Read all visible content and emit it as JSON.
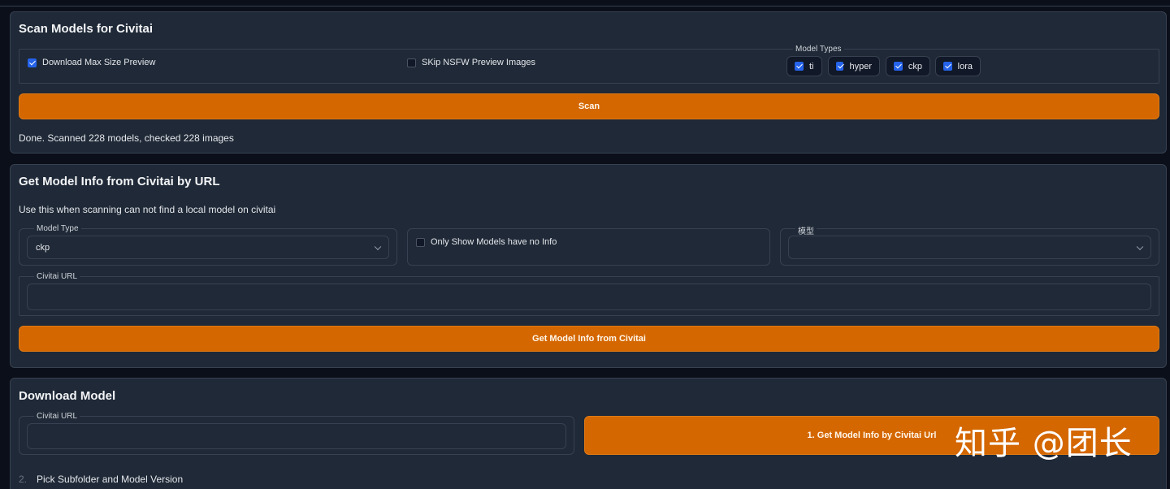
{
  "scan_section": {
    "title": "Scan Models for Civitai",
    "download_max_preview": {
      "label": "Download Max Size Preview",
      "checked": true
    },
    "skip_nsfw": {
      "label": "SKip NSFW Preview Images",
      "checked": false
    },
    "model_types": {
      "legend": "Model Types",
      "options": [
        {
          "label": "ti",
          "checked": true
        },
        {
          "label": "hyper",
          "checked": true
        },
        {
          "label": "ckp",
          "checked": true
        },
        {
          "label": "lora",
          "checked": true
        }
      ]
    },
    "scan_button": "Scan",
    "status": "Done. Scanned 228 models, checked 228 images"
  },
  "url_section": {
    "title": "Get Model Info from Civitai by URL",
    "description": "Use this when scanning can not find a local model on civitai",
    "model_type": {
      "label": "Model Type",
      "value": "ckp"
    },
    "only_no_info": {
      "label": "Only Show Models have no Info",
      "checked": false
    },
    "model_select": {
      "label": "模型",
      "value": ""
    },
    "civitai_url": {
      "label": "Civitai URL",
      "value": ""
    },
    "get_info_button": "Get Model Info from Civitai"
  },
  "download_section": {
    "title": "Download Model",
    "civitai_url": {
      "label": "Civitai URL",
      "value": ""
    },
    "step1_button": "1. Get Model Info by Civitai Url",
    "step2": {
      "number": "2.",
      "label": "Pick Subfolder and Model Version"
    }
  },
  "watermark": "知乎 @团长",
  "colors": {
    "accent": "#d46700",
    "panel": "#1f2937",
    "background": "#0b0f19",
    "checkbox": "#2563eb"
  }
}
